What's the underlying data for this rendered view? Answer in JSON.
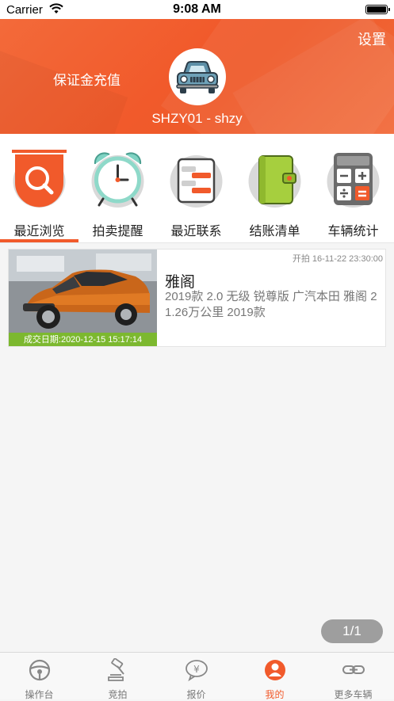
{
  "status_bar": {
    "carrier": "Carrier",
    "time": "9:08 AM"
  },
  "header": {
    "settings_label": "设置",
    "deposit_label": "保证金充值",
    "username": "SHZY01 - shzy",
    "accent_color": "#f15a2b"
  },
  "menu": {
    "items": [
      {
        "label": "最近浏览",
        "icon": "magnifier-icon",
        "active": true
      },
      {
        "label": "拍卖提醒",
        "icon": "alarm-clock-icon",
        "active": false
      },
      {
        "label": "最近联系",
        "icon": "chat-icon",
        "active": false
      },
      {
        "label": "结账清单",
        "icon": "wallet-icon",
        "active": false
      },
      {
        "label": "车辆统计",
        "icon": "calculator-icon",
        "active": false
      }
    ]
  },
  "listing": {
    "start_time": "开拍 16-11-22 23:30:00",
    "title": "雅阁",
    "description": "2019款 2.0 无级 锐尊版 广汽本田 雅阁 2",
    "meta": "1.26万公里 2019款",
    "deal_date": "成交日期:2020-12-15 15:17:14"
  },
  "pager": {
    "text": "1/1"
  },
  "tabbar": {
    "items": [
      {
        "label": "操作台",
        "icon": "steering-wheel-icon",
        "active": false
      },
      {
        "label": "竞拍",
        "icon": "gavel-icon",
        "active": false
      },
      {
        "label": "报价",
        "icon": "yen-bubble-icon",
        "active": false
      },
      {
        "label": "我的",
        "icon": "person-icon",
        "active": true
      },
      {
        "label": "更多车辆",
        "icon": "link-icon",
        "active": false
      }
    ]
  }
}
